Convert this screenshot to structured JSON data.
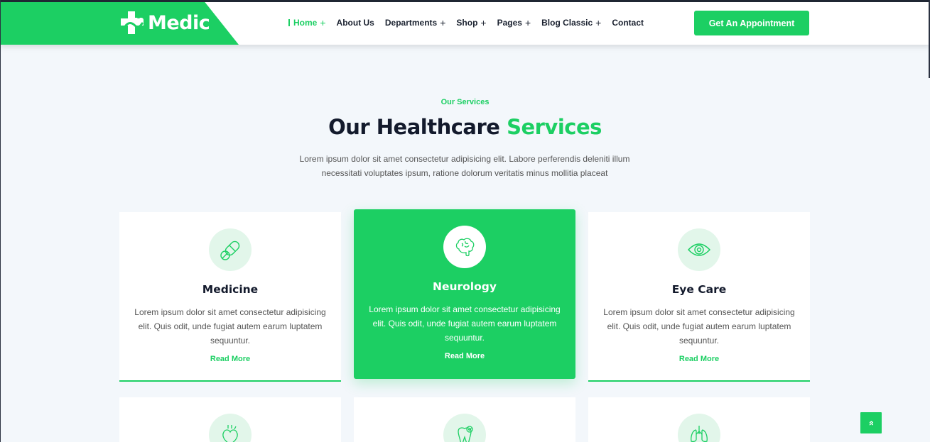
{
  "brand": {
    "name": "Medic",
    "color": "#1ccf63",
    "icon": "medical-cross-icon"
  },
  "nav": [
    {
      "label": "Home",
      "has_plus": true,
      "active": true
    },
    {
      "label": "About Us",
      "has_plus": false
    },
    {
      "label": "Departments",
      "has_plus": true
    },
    {
      "label": "Shop",
      "has_plus": true
    },
    {
      "label": "Pages",
      "has_plus": true
    },
    {
      "label": "Blog Classic",
      "has_plus": true
    },
    {
      "label": "Contact",
      "has_plus": false
    }
  ],
  "plus_glyph": "+",
  "cta_label": "Get An Appointment",
  "section": {
    "eyebrow": "Our Services",
    "title_main": "Our Healthcare",
    "title_accent": "Services",
    "lead": "Lorem ipsum dolor sit amet consectetur adipisicing elit. Labore perferendis deleniti illum necessitati voluptates ipsum, ratione dolorum veritatis minus mollitia placeat"
  },
  "services": [
    {
      "title": "Medicine",
      "icon": "pill-capsule-icon",
      "text": "Lorem ipsum dolor sit amet consectetur adipisicing elit. Quis odit, unde fugiat autem earum luptatem sequuntur.",
      "link": "Read More"
    },
    {
      "title": "Neurology",
      "icon": "brain-icon",
      "text": "Lorem ipsum dolor sit amet consectetur adipisicing elit. Quis odit, unde fugiat autem earum luptatem sequuntur.",
      "link": "Read More",
      "highlighted": true
    },
    {
      "title": "Eye Care",
      "icon": "eye-icon",
      "text": "Lorem ipsum dolor sit amet consectetur adipisicing elit. Quis odit, unde fugiat autem earum luptatem sequuntur.",
      "link": "Read More"
    }
  ],
  "services_row2_icons": [
    "heart-organ-icon",
    "tooth-check-icon",
    "lungs-icon"
  ],
  "scroll_top_icon": "double-chevron-up-icon",
  "scroll_top_glyph": "»"
}
